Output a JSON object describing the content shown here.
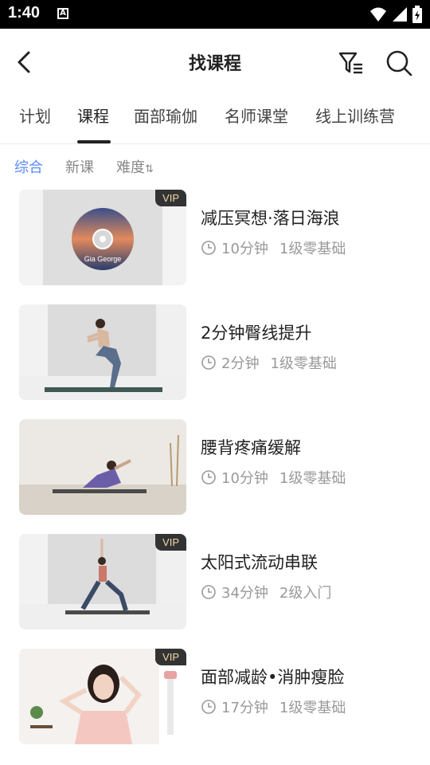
{
  "status": {
    "time": "1:40"
  },
  "header": {
    "title": "找课程"
  },
  "tabs": [
    {
      "label": "计划"
    },
    {
      "label": "课程"
    },
    {
      "label": "面部瑜伽"
    },
    {
      "label": "名师课堂"
    },
    {
      "label": "线上训练营"
    }
  ],
  "sort": {
    "items": [
      "综合",
      "新课",
      "难度"
    ],
    "difficulty_arrow": "⇅"
  },
  "courses": [
    {
      "title": "减压冥想·落日海浪",
      "duration": "10分钟",
      "level": "1级零基础",
      "vip": "VIP",
      "disc_text": "Gia George"
    },
    {
      "title": "2分钟臀线提升",
      "duration": "2分钟",
      "level": "1级零基础",
      "vip": ""
    },
    {
      "title": "腰背疼痛缓解",
      "duration": "10分钟",
      "level": "1级零基础",
      "vip": ""
    },
    {
      "title": "太阳式流动串联",
      "duration": "34分钟",
      "level": "2级入门",
      "vip": "VIP"
    },
    {
      "title": "面部减龄•消肿瘦脸",
      "duration": "17分钟",
      "level": "1级零基础",
      "vip": "VIP"
    }
  ],
  "colors": {
    "accent": "#5b8cf5",
    "vip_bg": "#333333",
    "vip_text": "#f0d9a6"
  }
}
